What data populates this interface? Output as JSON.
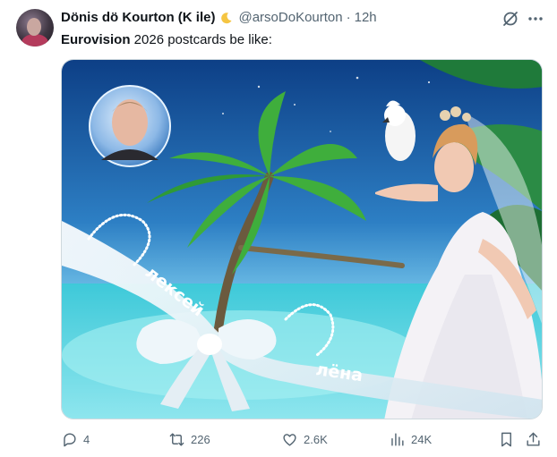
{
  "author": {
    "display_name": "Dönis dö Kourton (K ile)",
    "badge_icon": "crescent-moon-icon",
    "handle": "@arsoDoKourton",
    "separator": "·",
    "time": "12h"
  },
  "tweet": {
    "bold_word": "Eurovision",
    "text_rest": " 2026 postcards be like:"
  },
  "media": {
    "overlay_text_1": "лексей",
    "overlay_text_2": "лёна"
  },
  "actions": {
    "reply_count": "4",
    "retweet_count": "226",
    "like_count": "2.6K",
    "views_count": "24K"
  },
  "colors": {
    "muted": "#536471",
    "text": "#0f1419",
    "border": "#cfd9de"
  }
}
